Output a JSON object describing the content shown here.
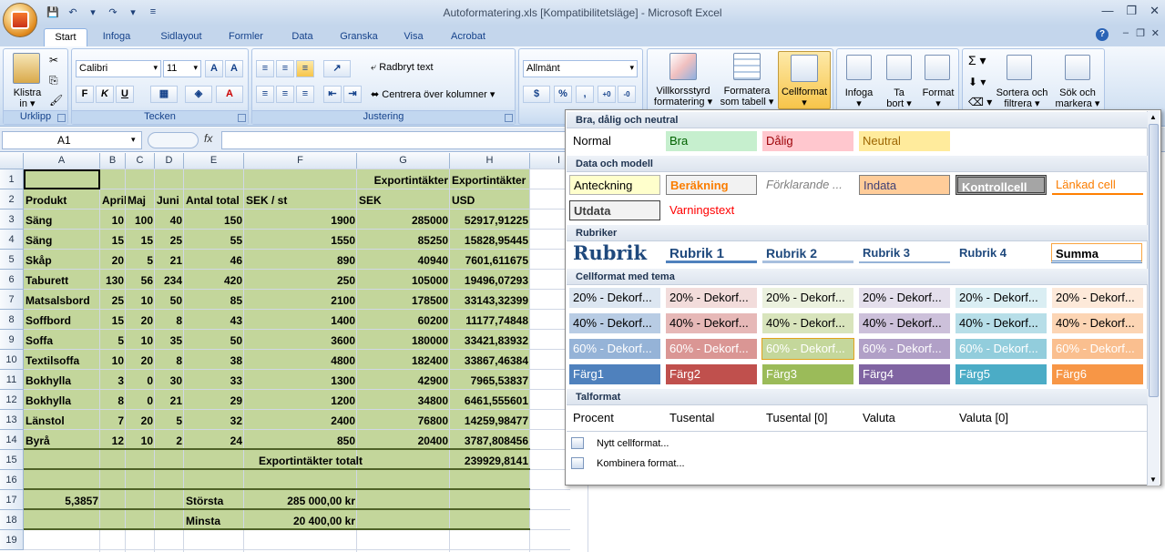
{
  "app": {
    "title": "Autoformatering.xls  [Kompatibilitetsläge] - Microsoft Excel",
    "tabs": [
      "Start",
      "Infoga",
      "Sidlayout",
      "Formler",
      "Data",
      "Granska",
      "Visa",
      "Acrobat"
    ],
    "active_tab": "Start"
  },
  "ribbon": {
    "clipboard": {
      "label": "Urklipp",
      "paste": "Klistra",
      "paste2": "in"
    },
    "font": {
      "label": "Tecken",
      "family": "Calibri",
      "size": "11",
      "bold": "F",
      "italic": "K",
      "underline": "U"
    },
    "alignment": {
      "label": "Justering",
      "wrap": "Radbryt text",
      "merge": "Centrera över kolumner"
    },
    "number": {
      "format": "Allmänt",
      "percent": "%",
      "comma": ","
    },
    "styles": {
      "cond1": "Villkorsstyrd",
      "cond2": "formatering",
      "table1": "Formatera",
      "table2": "som tabell",
      "cell": "Cellformat"
    },
    "cells": {
      "insert": "Infoga",
      "delete1": "Ta",
      "delete2": "bort",
      "format": "Format"
    },
    "editing": {
      "sigma": "Σ",
      "sort1": "Sortera och",
      "sort2": "filtrera",
      "find1": "Sök och",
      "find2": "markera"
    }
  },
  "formula_bar": {
    "namebox": "A1",
    "fx": "fx",
    "value": ""
  },
  "sheet": {
    "columns": [
      "A",
      "B",
      "C",
      "D",
      "E",
      "F",
      "G",
      "H",
      "I"
    ],
    "rows": [
      "1",
      "2",
      "3",
      "4",
      "5",
      "6",
      "7",
      "8",
      "9",
      "10",
      "11",
      "12",
      "13",
      "14",
      "15",
      "16",
      "17",
      "18",
      "19"
    ],
    "header1": {
      "g": "Exportintäkter",
      "h": "Exportintäkter"
    },
    "header2": {
      "a": "Produkt",
      "b": "April",
      "c": "Maj",
      "d": "Juni",
      "e": "Antal total",
      "f": "SEK / st",
      "g": "SEK",
      "h": "USD"
    },
    "data": [
      [
        "Säng",
        "10",
        "100",
        "40",
        "150",
        "1900",
        "285000",
        "52917,91225"
      ],
      [
        "Säng",
        "15",
        "15",
        "25",
        "55",
        "1550",
        "85250",
        "15828,95445"
      ],
      [
        "Skåp",
        "20",
        "5",
        "21",
        "46",
        "890",
        "40940",
        "7601,611675"
      ],
      [
        "Taburett",
        "130",
        "56",
        "234",
        "420",
        "250",
        "105000",
        "19496,07293"
      ],
      [
        "Matsalsbord",
        "25",
        "10",
        "50",
        "85",
        "2100",
        "178500",
        "33143,32399"
      ],
      [
        "Soffbord",
        "15",
        "20",
        "8",
        "43",
        "1400",
        "60200",
        "11177,74848"
      ],
      [
        "Soffa",
        "5",
        "10",
        "35",
        "50",
        "3600",
        "180000",
        "33421,83932"
      ],
      [
        "Textilsoffa",
        "10",
        "20",
        "8",
        "38",
        "4800",
        "182400",
        "33867,46384"
      ],
      [
        "Bokhylla",
        "3",
        "0",
        "30",
        "33",
        "1300",
        "42900",
        "7965,53837"
      ],
      [
        "Bokhylla",
        "8",
        "0",
        "21",
        "29",
        "1200",
        "34800",
        "6461,555601"
      ],
      [
        "Länstol",
        "7",
        "20",
        "5",
        "32",
        "2400",
        "76800",
        "14259,98477"
      ],
      [
        "Byrå",
        "12",
        "10",
        "2",
        "24",
        "850",
        "20400",
        "3787,808456"
      ]
    ],
    "total": {
      "label": "Exportintäkter totalt",
      "value": "239929,8141"
    },
    "rate": "5,3857",
    "max": {
      "label": "Största",
      "value": "285 000,00 kr"
    },
    "min": {
      "label": "Minsta",
      "value": "20 400,00 kr"
    }
  },
  "gallery": {
    "sections": {
      "good": "Bra, dålig och neutral",
      "data": "Data och modell",
      "headings": "Rubriker",
      "themed": "Cellformat med tema",
      "number": "Talformat"
    },
    "good_bad": [
      "Normal",
      "Bra",
      "Dålig",
      "Neutral"
    ],
    "data_model": [
      "Anteckning",
      "Beräkning",
      "Förklarande ...",
      "Indata",
      "Kontrollcell",
      "Länkad cell",
      "Utdata",
      "Varningstext"
    ],
    "headings": [
      "Rubrik",
      "Rubrik 1",
      "Rubrik 2",
      "Rubrik 3",
      "Rubrik 4",
      "Summa"
    ],
    "themed_20": [
      "20% - Dekorf...",
      "20% - Dekorf...",
      "20% - Dekorf...",
      "20% - Dekorf...",
      "20% - Dekorf...",
      "20% - Dekorf..."
    ],
    "themed_40": [
      "40% - Dekorf...",
      "40% - Dekorf...",
      "40% - Dekorf...",
      "40% - Dekorf...",
      "40% - Dekorf...",
      "40% - Dekorf..."
    ],
    "themed_60": [
      "60% - Dekorf...",
      "60% - Dekorf...",
      "60% - Dekorf...",
      "60% - Dekorf...",
      "60% - Dekorf...",
      "60% - Dekorf..."
    ],
    "themed_full": [
      "Färg1",
      "Färg2",
      "Färg3",
      "Färg4",
      "Färg5",
      "Färg6"
    ],
    "number_formats": [
      "Procent",
      "Tusental",
      "Tusental [0]",
      "Valuta",
      "Valuta [0]"
    ],
    "menu": {
      "new_style": "Nytt cellformat...",
      "merge": "Kombinera format..."
    }
  },
  "colors": {
    "sheet_fill": "#c3d69b",
    "accent1": "#4f81bd",
    "accent2": "#c0504d",
    "accent3": "#9bbb59",
    "accent4": "#8064a2",
    "accent5": "#4bacc6",
    "accent6": "#f79646"
  }
}
